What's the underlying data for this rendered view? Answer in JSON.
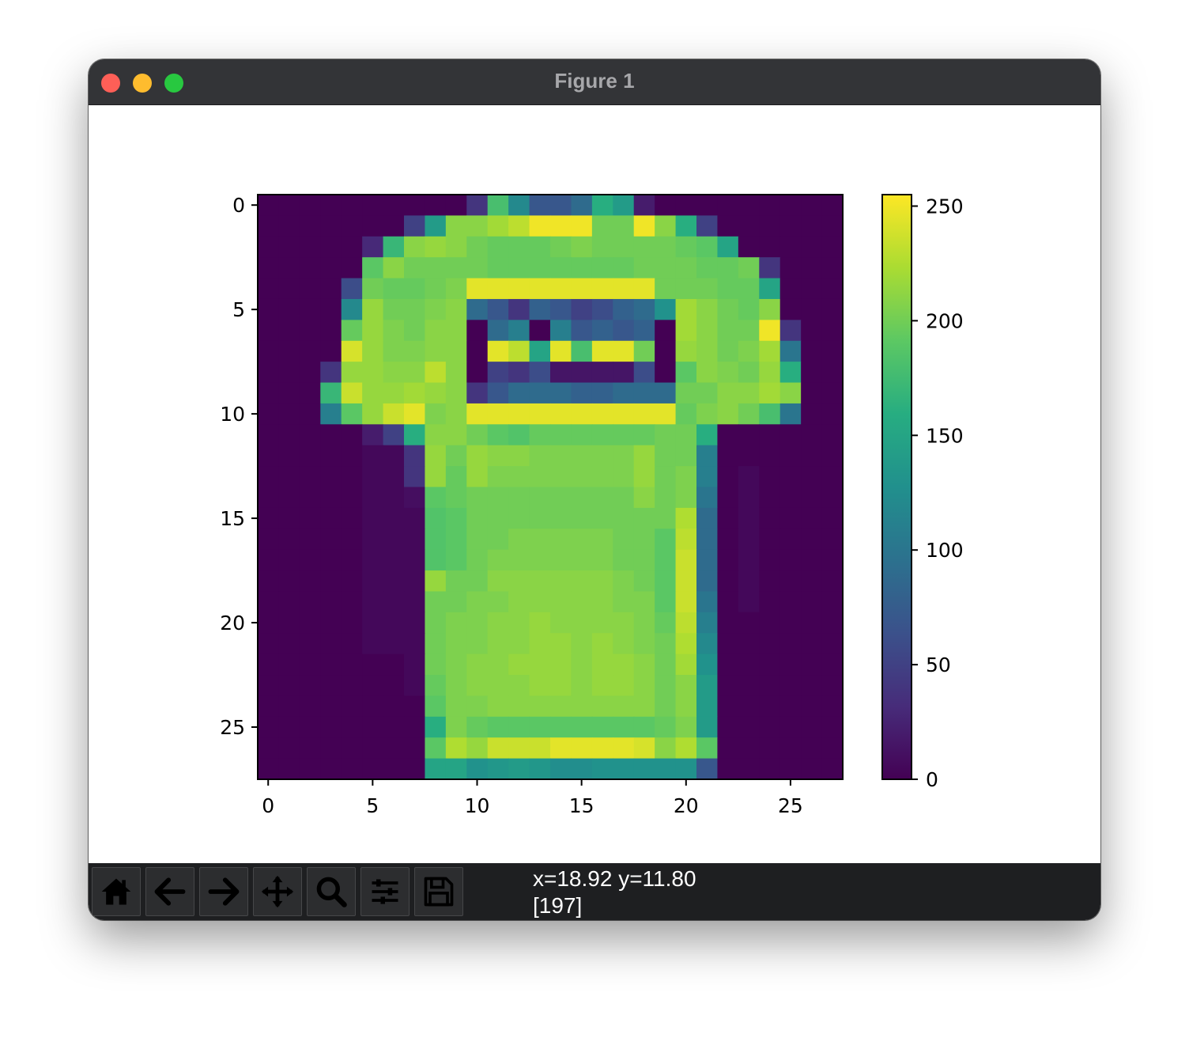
{
  "window": {
    "title": "Figure 1"
  },
  "toolbar": {
    "buttons": [
      {
        "name": "home-button",
        "icon": "home-icon"
      },
      {
        "name": "back-button",
        "icon": "arrow-left-icon"
      },
      {
        "name": "forward-button",
        "icon": "arrow-right-icon"
      },
      {
        "name": "pan-button",
        "icon": "move-icon"
      },
      {
        "name": "zoom-button",
        "icon": "magnifier-icon"
      },
      {
        "name": "configure-subplots-button",
        "icon": "sliders-icon"
      },
      {
        "name": "save-button",
        "icon": "floppy-disk-icon"
      }
    ],
    "coords_line1": "x=18.92 y=11.80",
    "coords_line2": "[197]"
  },
  "chart_data": {
    "type": "heatmap",
    "colormap": "viridis",
    "xlim": [
      -0.5,
      27.5
    ],
    "ylim": [
      27.5,
      -0.5
    ],
    "xticks": [
      0,
      5,
      10,
      15,
      20,
      25
    ],
    "yticks": [
      0,
      5,
      10,
      15,
      20,
      25
    ],
    "colorbar": {
      "min": 0,
      "max": 255,
      "ticks": [
        0,
        50,
        100,
        150,
        200,
        250
      ]
    },
    "values": [
      [
        0,
        0,
        0,
        0,
        0,
        0,
        0,
        0,
        0,
        0,
        40,
        180,
        120,
        70,
        70,
        90,
        160,
        140,
        20,
        0,
        0,
        0,
        0,
        0,
        0,
        0,
        0,
        0
      ],
      [
        0,
        0,
        0,
        0,
        0,
        0,
        0,
        50,
        140,
        210,
        210,
        220,
        230,
        250,
        250,
        250,
        200,
        200,
        250,
        210,
        160,
        50,
        0,
        0,
        0,
        0,
        0,
        0
      ],
      [
        0,
        0,
        0,
        0,
        0,
        30,
        170,
        210,
        215,
        210,
        200,
        195,
        195,
        195,
        200,
        205,
        200,
        200,
        200,
        200,
        195,
        190,
        150,
        0,
        0,
        0,
        0,
        0
      ],
      [
        0,
        0,
        0,
        0,
        0,
        190,
        210,
        200,
        200,
        200,
        200,
        195,
        195,
        195,
        195,
        195,
        195,
        195,
        200,
        200,
        200,
        195,
        195,
        200,
        40,
        0,
        0,
        0,
        0
      ],
      [
        0,
        0,
        0,
        0,
        60,
        200,
        195,
        195,
        200,
        205,
        245,
        245,
        245,
        245,
        245,
        245,
        245,
        245,
        245,
        200,
        200,
        200,
        195,
        195,
        150,
        0,
        0,
        0
      ],
      [
        0,
        0,
        0,
        0,
        120,
        215,
        200,
        200,
        205,
        210,
        90,
        70,
        40,
        80,
        70,
        50,
        60,
        80,
        90,
        130,
        220,
        210,
        200,
        195,
        210,
        0,
        0,
        0
      ],
      [
        0,
        0,
        0,
        0,
        195,
        215,
        205,
        200,
        210,
        210,
        0,
        90,
        110,
        0,
        110,
        70,
        80,
        70,
        80,
        0,
        220,
        210,
        200,
        200,
        250,
        40,
        0,
        0
      ],
      [
        0,
        0,
        0,
        0,
        240,
        215,
        205,
        205,
        210,
        210,
        0,
        245,
        230,
        150,
        245,
        180,
        245,
        245,
        200,
        0,
        215,
        210,
        200,
        205,
        220,
        100,
        0,
        0
      ],
      [
        0,
        0,
        0,
        40,
        215,
        215,
        210,
        210,
        230,
        210,
        0,
        50,
        40,
        60,
        15,
        15,
        15,
        15,
        60,
        0,
        190,
        210,
        205,
        200,
        215,
        160,
        0,
        0
      ],
      [
        0,
        0,
        0,
        170,
        235,
        215,
        215,
        220,
        215,
        210,
        40,
        70,
        90,
        90,
        90,
        80,
        80,
        90,
        90,
        90,
        200,
        200,
        210,
        210,
        220,
        210,
        0,
        0
      ],
      [
        0,
        0,
        0,
        110,
        190,
        215,
        235,
        245,
        205,
        210,
        245,
        245,
        245,
        245,
        245,
        245,
        245,
        245,
        245,
        245,
        195,
        205,
        210,
        200,
        180,
        100,
        0,
        0
      ],
      [
        0,
        0,
        0,
        0,
        0,
        20,
        50,
        160,
        210,
        210,
        200,
        190,
        185,
        195,
        195,
        195,
        195,
        195,
        195,
        200,
        200,
        160,
        0,
        0,
        0,
        0,
        0,
        0
      ],
      [
        0,
        0,
        0,
        0,
        0,
        5,
        5,
        40,
        215,
        200,
        215,
        210,
        210,
        205,
        205,
        205,
        205,
        205,
        215,
        200,
        200,
        110,
        0,
        0,
        0,
        0,
        0,
        0
      ],
      [
        0,
        0,
        0,
        0,
        0,
        5,
        5,
        40,
        215,
        195,
        215,
        205,
        205,
        205,
        205,
        205,
        205,
        205,
        215,
        200,
        205,
        110,
        0,
        5,
        0,
        0,
        0,
        0
      ],
      [
        0,
        0,
        0,
        0,
        0,
        5,
        5,
        10,
        190,
        195,
        200,
        200,
        200,
        200,
        200,
        200,
        200,
        200,
        210,
        200,
        205,
        100,
        0,
        5,
        0,
        0,
        0,
        0
      ],
      [
        0,
        0,
        0,
        0,
        0,
        5,
        5,
        5,
        185,
        190,
        200,
        200,
        200,
        200,
        200,
        200,
        200,
        200,
        200,
        200,
        225,
        90,
        0,
        5,
        0,
        0,
        0,
        0
      ],
      [
        0,
        0,
        0,
        0,
        0,
        5,
        5,
        5,
        185,
        190,
        200,
        200,
        205,
        205,
        205,
        205,
        205,
        200,
        200,
        190,
        230,
        90,
        0,
        5,
        0,
        0,
        0,
        0
      ],
      [
        0,
        0,
        0,
        0,
        0,
        5,
        5,
        5,
        185,
        190,
        200,
        205,
        205,
        205,
        205,
        205,
        205,
        200,
        200,
        190,
        235,
        90,
        0,
        5,
        0,
        0,
        0,
        0
      ],
      [
        0,
        0,
        0,
        0,
        0,
        5,
        5,
        5,
        215,
        200,
        200,
        210,
        210,
        210,
        210,
        210,
        210,
        205,
        200,
        190,
        235,
        90,
        0,
        5,
        0,
        0,
        0,
        0
      ],
      [
        0,
        0,
        0,
        0,
        0,
        5,
        5,
        5,
        200,
        200,
        205,
        205,
        210,
        210,
        210,
        210,
        210,
        205,
        205,
        190,
        235,
        100,
        0,
        5,
        0,
        0,
        0,
        0
      ],
      [
        0,
        0,
        0,
        0,
        0,
        5,
        5,
        5,
        200,
        205,
        205,
        210,
        210,
        215,
        210,
        210,
        210,
        210,
        205,
        195,
        230,
        110,
        0,
        0,
        0,
        0,
        0,
        0
      ],
      [
        0,
        0,
        0,
        0,
        0,
        5,
        5,
        5,
        200,
        205,
        205,
        210,
        210,
        215,
        215,
        210,
        215,
        210,
        205,
        200,
        225,
        120,
        0,
        0,
        0,
        0,
        0,
        0
      ],
      [
        0,
        0,
        0,
        0,
        0,
        0,
        0,
        5,
        200,
        205,
        210,
        210,
        215,
        215,
        215,
        210,
        215,
        215,
        210,
        200,
        220,
        130,
        0,
        0,
        0,
        0,
        0,
        0
      ],
      [
        0,
        0,
        0,
        0,
        0,
        0,
        0,
        5,
        195,
        205,
        210,
        210,
        210,
        215,
        215,
        210,
        215,
        215,
        210,
        200,
        210,
        140,
        0,
        0,
        0,
        0,
        0,
        0
      ],
      [
        0,
        0,
        0,
        0,
        0,
        0,
        0,
        0,
        190,
        205,
        205,
        210,
        210,
        210,
        210,
        210,
        210,
        210,
        210,
        200,
        210,
        140,
        0,
        0,
        0,
        0,
        0,
        0
      ],
      [
        0,
        0,
        0,
        0,
        0,
        0,
        0,
        0,
        160,
        205,
        195,
        190,
        190,
        190,
        190,
        190,
        190,
        190,
        190,
        195,
        205,
        140,
        0,
        0,
        0,
        0,
        0,
        0
      ],
      [
        0,
        0,
        0,
        0,
        0,
        0,
        0,
        0,
        190,
        225,
        215,
        235,
        235,
        235,
        245,
        245,
        245,
        245,
        240,
        210,
        225,
        190,
        0,
        0,
        0,
        0,
        0,
        0
      ],
      [
        0,
        0,
        0,
        0,
        0,
        0,
        0,
        0,
        150,
        150,
        130,
        135,
        140,
        135,
        125,
        125,
        130,
        130,
        130,
        130,
        130,
        70,
        0,
        0,
        0,
        0,
        0,
        0
      ]
    ]
  }
}
